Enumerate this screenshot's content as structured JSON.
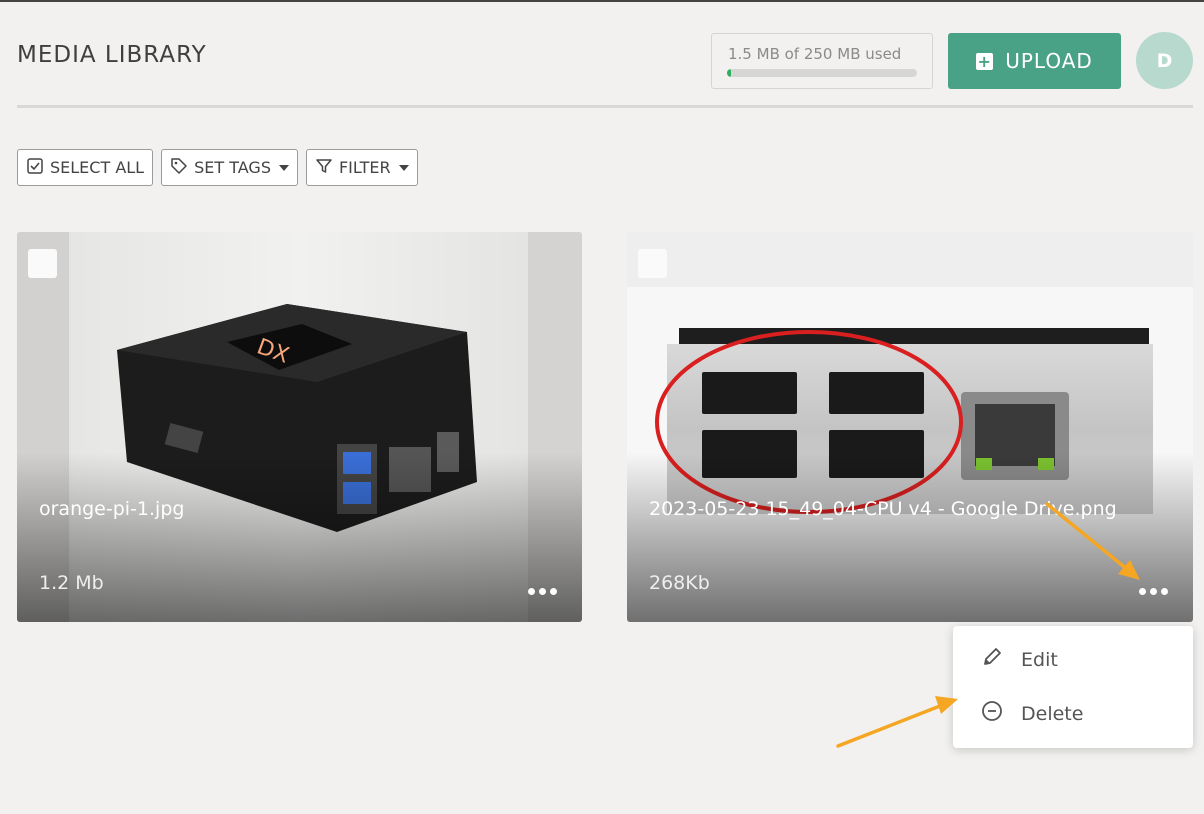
{
  "header": {
    "title": "MEDIA LIBRARY",
    "storage_text": "1.5 MB of 250 MB used",
    "storage_fraction": 0.006,
    "upload_label": "UPLOAD",
    "avatar_initial": "D"
  },
  "toolbar": {
    "select_all_label": "SELECT ALL",
    "set_tags_label": "SET TAGS",
    "filter_label": "FILTER"
  },
  "media": [
    {
      "name": "orange-pi-1.jpg",
      "size": "1.2 Mb"
    },
    {
      "name": "2023-05-23 15_49_04-CPU v4 - Google Drive.png",
      "size": "268Kb"
    }
  ],
  "menu": {
    "edit_label": "Edit",
    "delete_label": "Delete"
  },
  "colors": {
    "accent": "#4aa286",
    "annotation_arrow": "#f5a623",
    "annotation_circle": "#d91f1f"
  }
}
